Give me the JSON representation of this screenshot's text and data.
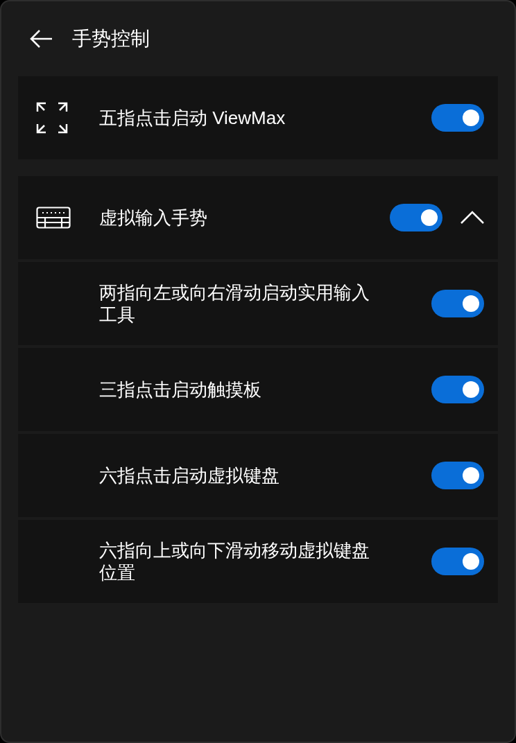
{
  "header": {
    "title": "手势控制"
  },
  "groups": [
    {
      "label": "五指点击启动 ViewMax",
      "on": true
    },
    {
      "label": "虚拟输入手势",
      "on": true,
      "expanded": true,
      "children": [
        {
          "label": "两指向左或向右滑动启动实用输入工具",
          "on": true
        },
        {
          "label": "三指点击启动触摸板",
          "on": true
        },
        {
          "label": "六指点击启动虚拟键盘",
          "on": true
        },
        {
          "label": "六指向上或向下滑动移动虚拟键盘位置",
          "on": true
        }
      ]
    }
  ]
}
